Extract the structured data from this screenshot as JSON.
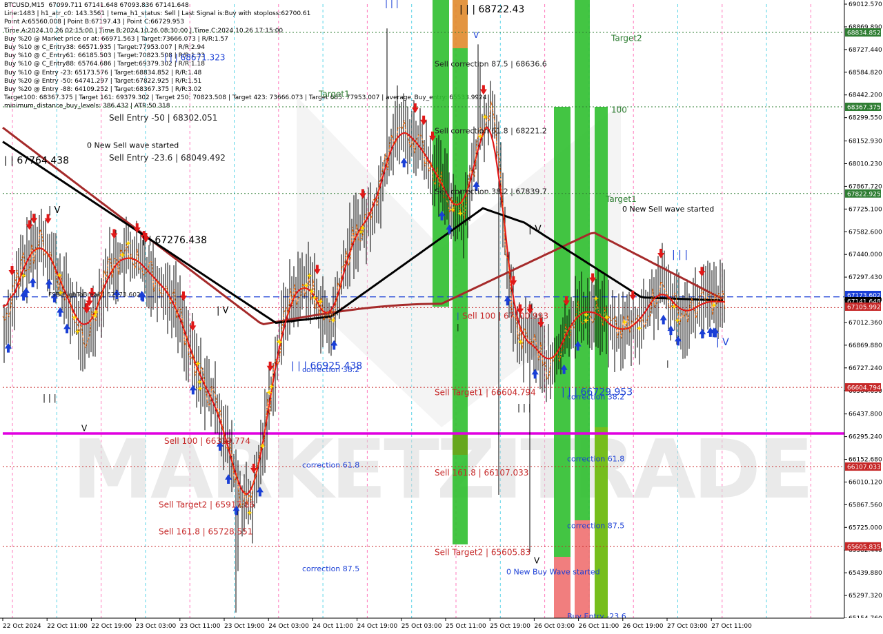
{
  "header": {
    "lines": [
      "BTCUSD,M15  67099.711 67141.648 67093.836 67141.648",
      "Line:1483 | h1_atr_c0: 143.3561 | tema_h1_status: Sell | Last Signal is:Buy with stoploss:62700.61",
      "Point A:65560.008 | Point B:67197.43 | Point C:66729.953",
      "Time A:2024.10.26 02:15:00 | Time B:2024.10.26 08:30:00 | Time C:2024.10.26 17:15:00",
      "Buy %20 @ Market price or at: 66971.563 | Target:73666.073 | R/R:1.57",
      "Buy %10 @ C_Entry38: 66571.935 | Target:77953.007 | R/R:2.94",
      "Buy %10 @ C_Entry61: 66185.503 | Target:70823.508 | R/R:1.33",
      "Buy %10 @ C_Entry88: 65764.686 | Target:69379.302 | R/R:1.18",
      "Buy %10 @ Entry -23: 65173.576 | Target:68834.852 | R/R:1.48",
      "Buy %20 @ Entry -50: 64741.297 | Target:67822.925 | R/R:1.51",
      "Buy %20 @ Entry -88: 64109.252 | Target:68367.375 | R/R:3.02",
      "Target100: 68367.375 | Target 161: 69379.302 | Target 250: 70823.508 | Target 423: 73666.073 | Target 685: 77953.007 | average_Buy_entry: 65533.9924",
      "minimum_distance_buy_levels: 386.432 | ATR:50.318"
    ]
  },
  "chart_data": {
    "type": "line",
    "symbol": "BTCUSD",
    "timeframe": "M15",
    "ylim": [
      65154.76,
      69012.57
    ],
    "y_ticks": [
      "69012.570",
      "68869.890",
      "68727.440",
      "68584.820",
      "68442.200",
      "68299.550",
      "68152.930",
      "68010.230",
      "67867.720",
      "67725.100",
      "67582.600",
      "67440.000",
      "67297.430",
      "67154.900",
      "67012.360",
      "66869.880",
      "66727.240",
      "66584.650",
      "66437.800",
      "66295.240",
      "66152.680",
      "66010.120",
      "65867.560",
      "65725.000",
      "65582.440",
      "65439.880",
      "65297.320",
      "65154.760"
    ],
    "x_ticks": [
      "22 Oct 2024",
      "22 Oct 11:00",
      "22 Oct 19:00",
      "23 Oct 03:00",
      "23 Oct 11:00",
      "23 Oct 19:00",
      "24 Oct 03:00",
      "24 Oct 11:00",
      "24 Oct 19:00",
      "25 Oct 03:00",
      "25 Oct 11:00",
      "25 Oct 19:00",
      "26 Oct 03:00",
      "26 Oct 11:00",
      "26 Oct 19:00",
      "27 Oct 03:00",
      "27 Oct 11:00"
    ],
    "price_badges": [
      {
        "value": "68834.852",
        "color": "#2e7d32"
      },
      {
        "value": "68367.375",
        "color": "#2e7d32"
      },
      {
        "value": "67822.925",
        "color": "#2e7d32"
      },
      {
        "value": "67173.602",
        "color": "#1a3fd6"
      },
      {
        "value": "67141.648",
        "color": "#000000"
      },
      {
        "value": "67105.992",
        "color": "#c62828"
      },
      {
        "value": "66604.794",
        "color": "#c62828"
      },
      {
        "value": "66107.033",
        "color": "#c62828"
      },
      {
        "value": "65605.835",
        "color": "#c62828"
      }
    ],
    "levels": [
      {
        "value": 68834.852,
        "color": "#2e7d32",
        "style": "dotted"
      },
      {
        "value": 68367.375,
        "color": "#2e7d32",
        "style": "dotted"
      },
      {
        "value": 67822.925,
        "color": "#2e7d32",
        "style": "dotted"
      },
      {
        "value": 67173.602,
        "color": "#1a3fd6",
        "style": "dashed"
      },
      {
        "value": 67105.992,
        "color": "#c62828",
        "style": "dotted"
      },
      {
        "value": 66604.794,
        "color": "#c62828",
        "style": "dotted"
      },
      {
        "value": 66107.033,
        "color": "#c62828",
        "style": "dotted"
      },
      {
        "value": 65605.835,
        "color": "#c62828",
        "style": "dotted"
      },
      {
        "value": 66315,
        "color": "#e000e0",
        "style": "solid"
      }
    ],
    "annotations": [
      {
        "text": "| | | 68722.43",
        "x": "25 Oct 10:30",
        "y": 68960,
        "color": "#000000",
        "size": 14
      },
      {
        "text": "| | |",
        "x": "24 Oct 21:00",
        "y": 69000,
        "color": "#1a3fd6",
        "size": 12
      },
      {
        "text": "V",
        "x": "25 Oct 13:00",
        "y": 68800,
        "color": "#1a3fd6",
        "size": 12
      },
      {
        "text": "Target2",
        "x": "26 Oct 14:00",
        "y": 68780,
        "color": "#2e7d32",
        "size": 12
      },
      {
        "text": "Target1",
        "x": "24 Oct 09:00",
        "y": 68430,
        "color": "#2e7d32",
        "size": 12
      },
      {
        "text": "100",
        "x": "26 Oct 14:00",
        "y": 68330,
        "color": "#2e7d32",
        "size": 12
      },
      {
        "text": "Target1",
        "x": "26 Oct 13:00",
        "y": 67770,
        "color": "#2e7d32",
        "size": 12
      },
      {
        "text": "Sell correction 87.5 | 68636.6",
        "x": "25 Oct 06:00",
        "y": 68620,
        "color": "#222222",
        "size": 11
      },
      {
        "text": "Sell correction 61.8 | 68221.2",
        "x": "25 Oct 06:00",
        "y": 68200,
        "color": "#222222",
        "size": 11
      },
      {
        "text": "Sell correction 38.2 | 67839.7",
        "x": "25 Oct 06:00",
        "y": 67820,
        "color": "#222222",
        "size": 11
      },
      {
        "text": "Sell Entry -50 | 68302.051",
        "x": "22 Oct 19:00",
        "y": 68280,
        "color": "#222222",
        "size": 12
      },
      {
        "text": "Sell Entry -23.6 | 68049.492",
        "x": "22 Oct 19:00",
        "y": 68030,
        "color": "#222222",
        "size": 12
      },
      {
        "text": "| | | 68671.323",
        "x": "23 Oct 05:00",
        "y": 68660,
        "color": "#1a3fd6",
        "size": 12
      },
      {
        "text": "0 New Sell wave started",
        "x": "22 Oct 15:00",
        "y": 68110,
        "color": "#000000",
        "size": 11
      },
      {
        "text": "| | 67764.438",
        "x": "22 Oct 00:00",
        "y": 68010,
        "color": "#000000",
        "size": 14
      },
      {
        "text": "| V",
        "x": "22 Oct 08:00",
        "y": 67700,
        "color": "#000000",
        "size": 13
      },
      {
        "text": "| | 67276.438",
        "x": "23 Oct 01:00",
        "y": 67510,
        "color": "#000000",
        "size": 14
      },
      {
        "text": "| V",
        "x": "23 Oct 14:30",
        "y": 67070,
        "color": "#000000",
        "size": 13
      },
      {
        "text": "FSB-HighToBreak | 67173.602",
        "x": "22 Oct 08:00",
        "y": 67175,
        "color": "#222222",
        "size": 9
      },
      {
        "text": "| | |",
        "x": "22 Oct 07:00",
        "y": 66520,
        "color": "#000000",
        "size": 12
      },
      {
        "text": "V",
        "x": "22 Oct 14:00",
        "y": 66330,
        "color": "#000000",
        "size": 12
      },
      {
        "text": "| | | 66925.438",
        "x": "24 Oct 04:00",
        "y": 66720,
        "color": "#1a3fd6",
        "size": 14
      },
      {
        "text": "correction 38.2",
        "x": "24 Oct 06:00",
        "y": 66700,
        "color": "#1a3fd6",
        "size": 11
      },
      {
        "text": "Sell 100 | 66319.774",
        "x": "23 Oct 05:00",
        "y": 66250,
        "color": "#c62828",
        "size": 12
      },
      {
        "text": "correction 61.8",
        "x": "24 Oct 06:00",
        "y": 66100,
        "color": "#1a3fd6",
        "size": 11
      },
      {
        "text": "Sell Target2 | 65917.86",
        "x": "23 Oct 04:00",
        "y": 65850,
        "color": "#c62828",
        "size": 12
      },
      {
        "text": "Sell 161.8 | 65728.551",
        "x": "23 Oct 04:00",
        "y": 65680,
        "color": "#c62828",
        "size": 12
      },
      {
        "text": "correction 87.5",
        "x": "24 Oct 06:00",
        "y": 65450,
        "color": "#1a3fd6",
        "size": 11
      },
      {
        "text": "| V",
        "x": "25 Oct 23:00",
        "y": 67580,
        "color": "#000000",
        "size": 14
      },
      {
        "text": "Sell 100 | 67100.993",
        "x": "25 Oct 11:00",
        "y": 67035,
        "color": "#c62828",
        "size": 12
      },
      {
        "text": "|",
        "x": "25 Oct 10:00",
        "y": 67040,
        "color": "#1a3fd6",
        "size": 11
      },
      {
        "text": "|",
        "x": "25 Oct 10:00",
        "y": 66970,
        "color": "#000000",
        "size": 11
      },
      {
        "text": "Sell Target1 | 66604.794",
        "x": "25 Oct 06:00",
        "y": 66555,
        "color": "#c62828",
        "size": 12
      },
      {
        "text": "| | |",
        "x": "25 Oct 21:00",
        "y": 66460,
        "color": "#000000",
        "size": 12
      },
      {
        "text": "Sell 161.8 | 66107.033",
        "x": "25 Oct 06:00",
        "y": 66050,
        "color": "#c62828",
        "size": 12
      },
      {
        "text": "Sell Target2 | 65605.83",
        "x": "25 Oct 06:00",
        "y": 65550,
        "color": "#c62828",
        "size": 12
      },
      {
        "text": "V",
        "x": "26 Oct 00:00",
        "y": 65500,
        "color": "#000000",
        "size": 12
      },
      {
        "text": "0 New Buy Wave started",
        "x": "25 Oct 19:00",
        "y": 65430,
        "color": "#1a3fd6",
        "size": 11
      },
      {
        "text": "| | | 66729.953",
        "x": "26 Oct 05:00",
        "y": 66555,
        "color": "#1a3fd6",
        "size": 14
      },
      {
        "text": "correction 38.2",
        "x": "26 Oct 06:00",
        "y": 66530,
        "color": "#1a3fd6",
        "size": 11
      },
      {
        "text": "correction 61.8",
        "x": "26 Oct 06:00",
        "y": 66140,
        "color": "#1a3fd6",
        "size": 11
      },
      {
        "text": "correction 87.5",
        "x": "26 Oct 06:00",
        "y": 65720,
        "color": "#1a3fd6",
        "size": 11
      },
      {
        "text": "Buy Entry -23.6",
        "x": "26 Oct 06:00",
        "y": 65150,
        "color": "#1a3fd6",
        "size": 11
      },
      {
        "text": "0 New Sell wave started",
        "x": "26 Oct 16:00",
        "y": 67710,
        "color": "#000000",
        "size": 11
      },
      {
        "text": "| | |",
        "x": "27 Oct 01:00",
        "y": 67420,
        "color": "#1a3fd6",
        "size": 14
      },
      {
        "text": "| V",
        "x": "27 Oct 09:00",
        "y": 66870,
        "color": "#1a3fd6",
        "size": 14
      },
      {
        "text": "|",
        "x": "27 Oct 00:00",
        "y": 66740,
        "color": "#000000",
        "size": 11
      }
    ],
    "watermark": "MARKETZITRADE"
  }
}
